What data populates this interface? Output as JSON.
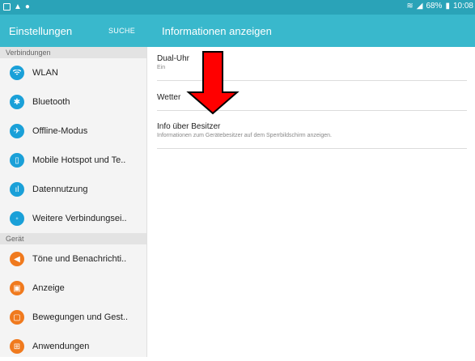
{
  "status": {
    "battery": "68%",
    "time": "10:08"
  },
  "header": {
    "left_title": "Einstellungen",
    "search": "SUCHE",
    "right_title": "Informationen anzeigen"
  },
  "sidebar": {
    "sections": [
      {
        "title": "Verbindungen",
        "items": [
          {
            "label": "WLAN",
            "icon": "wifi-icon"
          },
          {
            "label": "Bluetooth",
            "icon": "bluetooth-icon"
          },
          {
            "label": "Offline-Modus",
            "icon": "airplane-icon"
          },
          {
            "label": "Mobile Hotspot und Te..",
            "icon": "hotspot-icon"
          },
          {
            "label": "Datennutzung",
            "icon": "data-usage-icon"
          },
          {
            "label": "Weitere Verbindungsei..",
            "icon": "more-connections-icon"
          }
        ]
      },
      {
        "title": "Gerät",
        "items": [
          {
            "label": "Töne und Benachrichti..",
            "icon": "sound-icon"
          },
          {
            "label": "Anzeige",
            "icon": "display-icon"
          },
          {
            "label": "Bewegungen und Gest..",
            "icon": "motion-icon"
          },
          {
            "label": "Anwendungen",
            "icon": "apps-icon"
          }
        ]
      }
    ]
  },
  "content": {
    "items": [
      {
        "title": "Dual-Uhr",
        "subtitle": "Ein"
      },
      {
        "title": "Wetter",
        "subtitle": ""
      },
      {
        "title": "Info über Besitzer",
        "subtitle": "Informationen zum Gerätebesitzer auf dem Sperrbildschirm anzeigen."
      }
    ]
  },
  "annotation": {
    "color": "#ff0000"
  }
}
